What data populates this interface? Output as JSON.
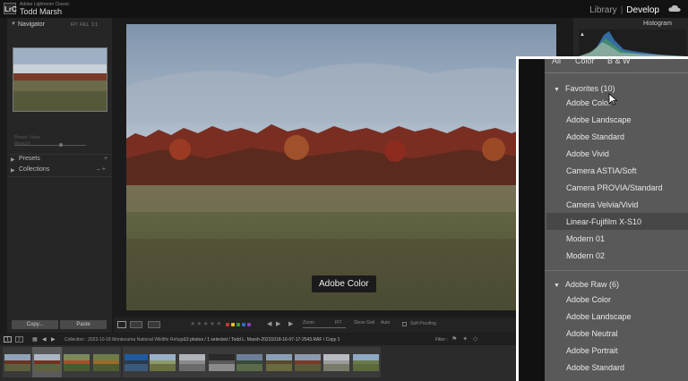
{
  "window": {
    "app_name": "Adobe Lightroom Classic",
    "user": "Todd Marsh",
    "logo": "LrC",
    "modules": [
      "Library",
      "Develop"
    ],
    "active_module": "Develop"
  },
  "left_panel": {
    "navigator": {
      "label": "Navigator",
      "zoom_options": [
        "FIT",
        "FILL",
        "1:1"
      ]
    },
    "preset_amount_label": "Preset: None",
    "amount_label": "Amount",
    "presets": "Presets",
    "collections": "Collections",
    "copy": "Copy...",
    "paste": "Paste"
  },
  "main_image": {
    "profile_tooltip": "Adobe Color"
  },
  "toolbar": {
    "zoom_label": "Zoom",
    "fit_label": "FIT",
    "show_grid_label": "Show Grid",
    "auto_label": "Auto",
    "soft_proofing": "Soft Proofing",
    "label_colors": [
      "#c0392b",
      "#e6c11f",
      "#3a9a3a",
      "#2f6fc4",
      "#8a3db0"
    ]
  },
  "right_panel": {
    "histogram_label": "Histogram"
  },
  "filmstrip": {
    "collection_text": "Collection : 2023-10-18 Montezuma National Wildlife Refuge",
    "selection_text": "13 photos / 1 selected / Todd L. Marsh-20231018-16-07-17-2543.RAF / Copy 1",
    "filter_label": "Filter :",
    "thumb_count": 13,
    "selected_index": 1
  },
  "profile_browser": {
    "tabs": [
      "All",
      "Color",
      "B & W"
    ],
    "groups": [
      {
        "title": "Favorites (10)",
        "items": [
          "Adobe Color",
          "Adobe Landscape",
          "Adobe Standard",
          "Adobe Vivid",
          "Camera ASTIA/Soft",
          "Camera PROVIA/Standard",
          "Camera Velvia/Vivid",
          "Linear-Fujifilm X-S10",
          "Modern 01",
          "Modern 02"
        ]
      },
      {
        "title": "Adobe Raw (6)",
        "items": [
          "Adobe Color",
          "Adobe Landscape",
          "Adobe Neutral",
          "Adobe Portrait",
          "Adobe Standard"
        ]
      }
    ],
    "hovered_item": "Linear-Fujifilm X-S10"
  }
}
